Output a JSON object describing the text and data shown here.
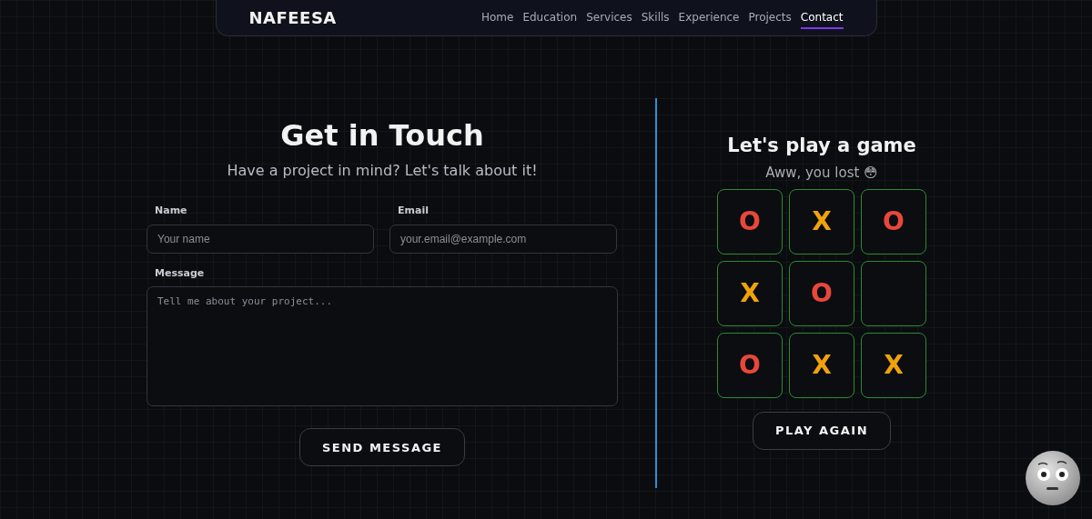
{
  "navbar": {
    "brand": "NAFEESA",
    "links": [
      {
        "label": "Home",
        "selected": false
      },
      {
        "label": "Education",
        "selected": false
      },
      {
        "label": "Services",
        "selected": false
      },
      {
        "label": "Skills",
        "selected": false
      },
      {
        "label": "Experience",
        "selected": false
      },
      {
        "label": "Projects",
        "selected": false
      },
      {
        "label": "Contact",
        "selected": true
      }
    ]
  },
  "contact": {
    "title": "Get in Touch",
    "subtitle": "Have a project in mind? Let's talk about it!",
    "fields": [
      {
        "kind": "input",
        "label": "Name",
        "placeholder": "Your name"
      },
      {
        "kind": "input",
        "label": "Email",
        "placeholder": "your.email@example.com"
      },
      {
        "kind": "textarea",
        "label": "Message",
        "placeholder": "Tell me about your project..."
      }
    ],
    "button": "SEND MESSAGE"
  },
  "game": {
    "title": "Let's play a game",
    "status": "Aww, you lost 😳",
    "cells": [
      {
        "kind": "o",
        "mark": "O"
      },
      {
        "kind": "x",
        "mark": "X"
      },
      {
        "kind": "o",
        "mark": "O"
      },
      {
        "kind": "x",
        "mark": "X"
      },
      {
        "kind": "o",
        "mark": "O"
      },
      {
        "kind": "empty"
      },
      {
        "kind": "o",
        "mark": "O"
      },
      {
        "kind": "x",
        "mark": "X"
      },
      {
        "kind": "x",
        "mark": "X"
      }
    ],
    "button": "PLAY AGAIN"
  }
}
